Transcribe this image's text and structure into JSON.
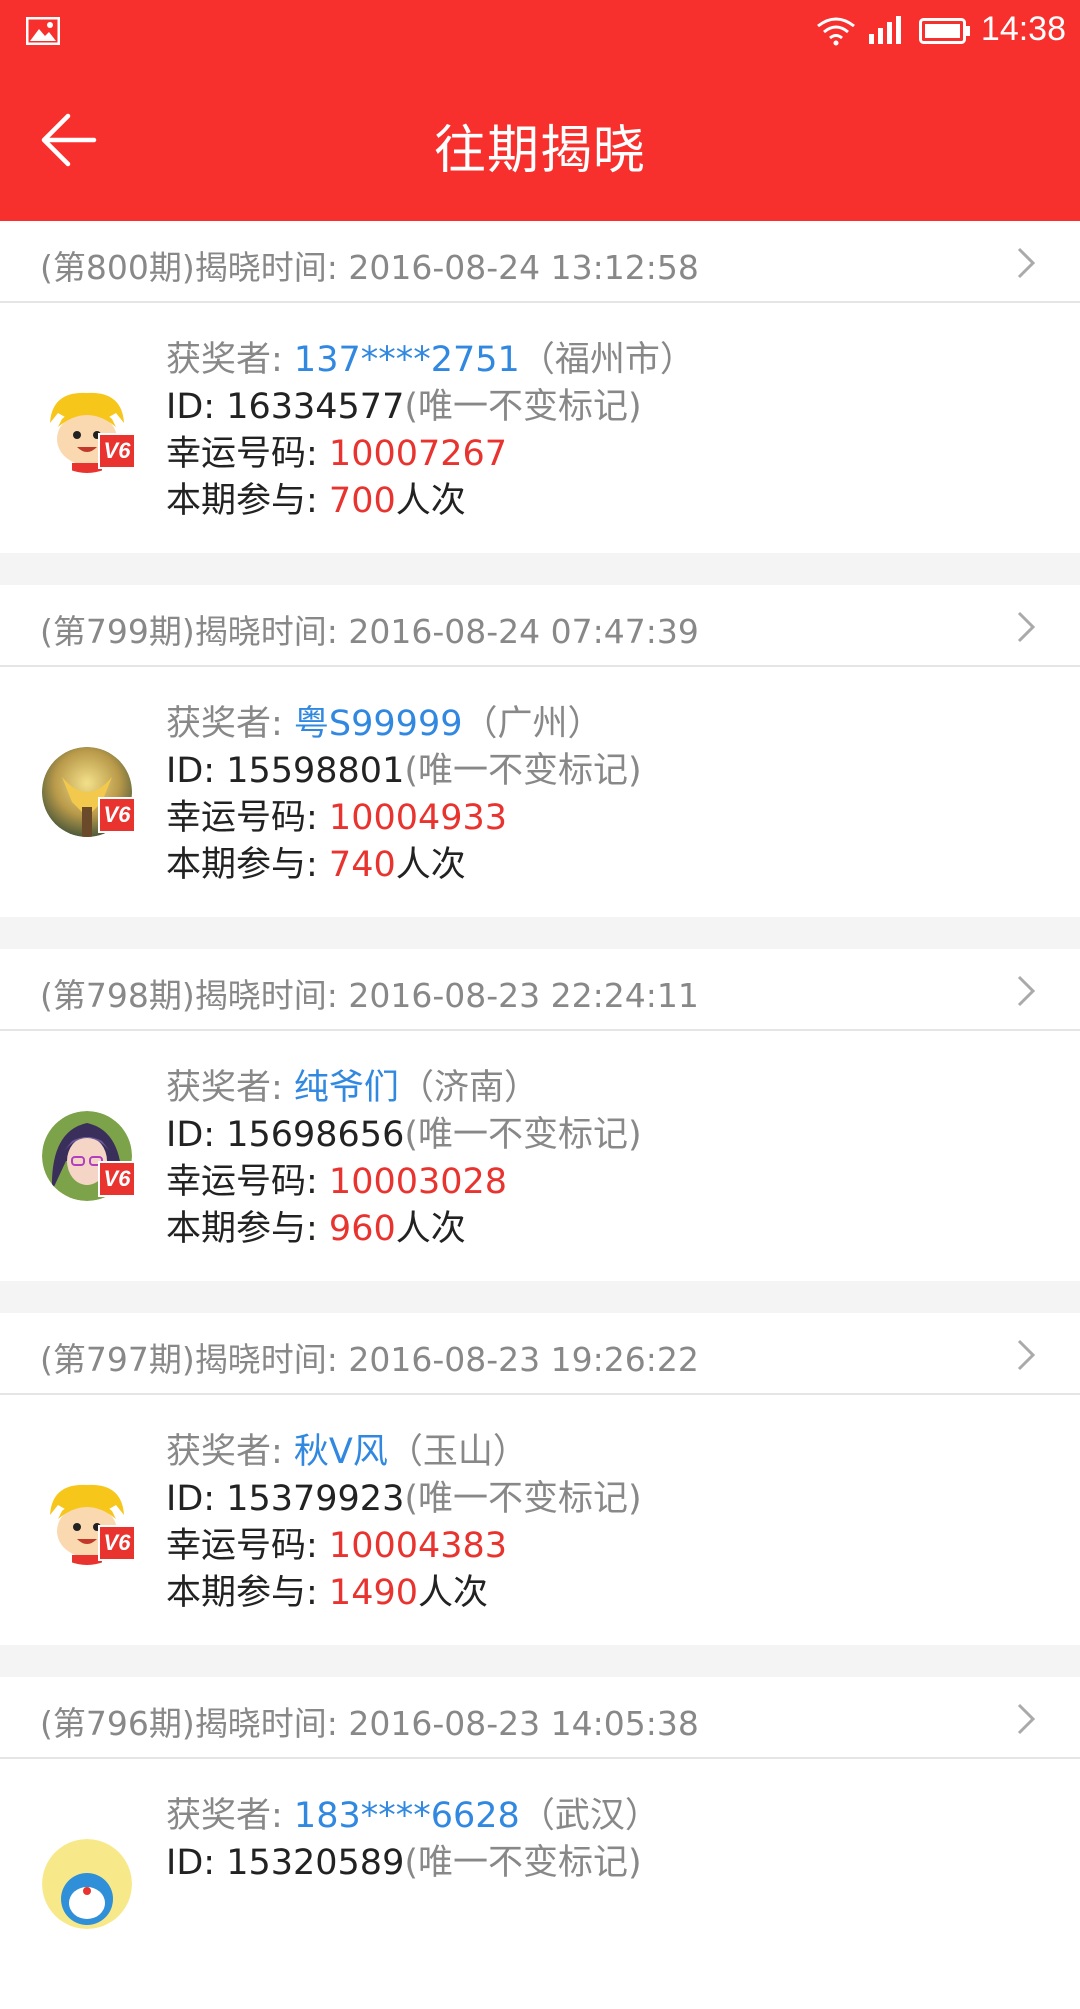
{
  "status": {
    "time": "14:38"
  },
  "header": {
    "title": "往期揭晓"
  },
  "labels": {
    "winner": "获奖者: ",
    "id_prefix": "ID: ",
    "id_note": "(唯一不变标记)",
    "lucky": "幸运号码: ",
    "joined": "本期参与: ",
    "joined_unit": "人次",
    "vip_badge": "V6"
  },
  "periods": [
    {
      "header": "(第800期)揭晓时间: 2016-08-24 13:12:58",
      "winner": "137****2751",
      "location": "（福州市）",
      "id": "16334577",
      "lucky": "10007267",
      "count": "700",
      "avatar": "cartoon-boy"
    },
    {
      "header": "(第799期)揭晓时间: 2016-08-24 07:47:39",
      "winner": "粤S99999",
      "location": "（广州）",
      "id": "15598801",
      "lucky": "10004933",
      "count": "740",
      "avatar": "flower-photo"
    },
    {
      "header": "(第798期)揭晓时间: 2016-08-23 22:24:11",
      "winner": "纯爷们",
      "location": "（济南）",
      "id": "15698656",
      "lucky": "10003028",
      "count": "960",
      "avatar": "anime-girl"
    },
    {
      "header": "(第797期)揭晓时间: 2016-08-23 19:26:22",
      "winner": "秋V风",
      "location": "（玉山）",
      "id": "15379923",
      "lucky": "10004383",
      "count": "1490",
      "avatar": "cartoon-boy"
    },
    {
      "header": "(第796期)揭晓时间: 2016-08-23 14:05:38",
      "winner": "183****6628",
      "location": "（武汉）",
      "id": "15320589",
      "lucky": "",
      "count": "",
      "avatar": "doraemon"
    }
  ]
}
